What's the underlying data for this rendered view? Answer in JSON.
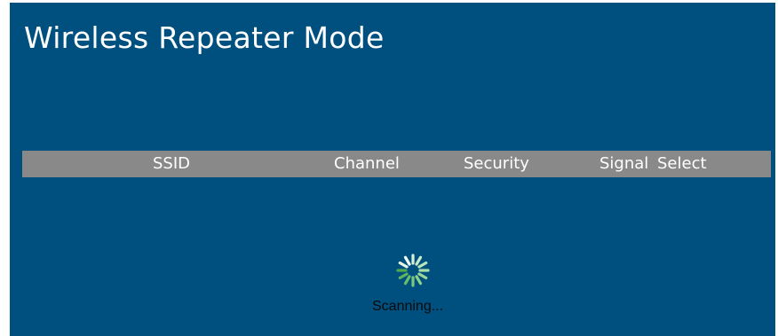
{
  "page": {
    "title": "Wireless Repeater Mode"
  },
  "table": {
    "columns": {
      "ssid": "SSID",
      "channel": "Channel",
      "security": "Security",
      "signal": "Signal",
      "select": "Select"
    },
    "rows": []
  },
  "status": {
    "text": "Scanning...",
    "icon": "loading-spinner-icon"
  },
  "colors": {
    "panel_background": "#00507f",
    "header_bar": "#898989",
    "spinner": "#7cc87a"
  }
}
